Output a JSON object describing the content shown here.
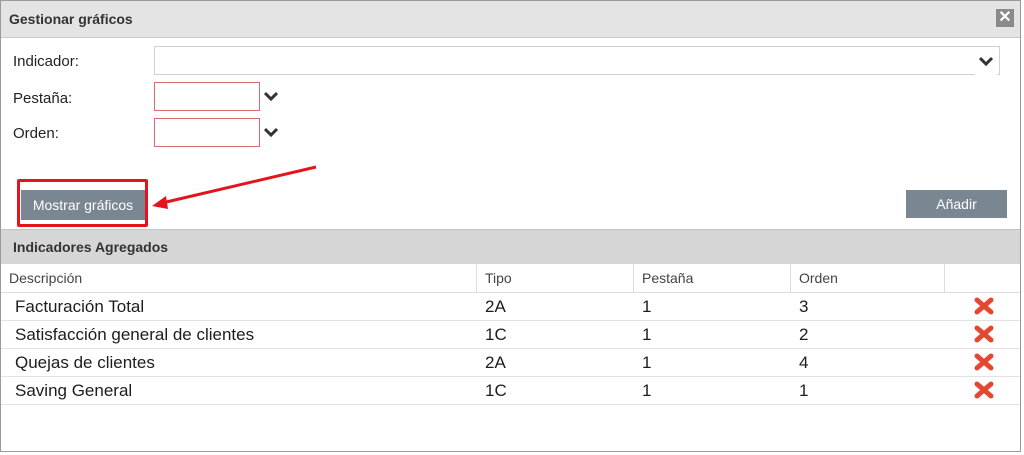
{
  "dialog": {
    "title": "Gestionar gráficos"
  },
  "form": {
    "indicador_label": "Indicador:",
    "pestana_label": "Pestaña:",
    "orden_label": "Orden:",
    "indicador_value": "",
    "pestana_value": "",
    "orden_value": ""
  },
  "buttons": {
    "mostrar": "Mostrar gráficos",
    "anadir": "Añadir"
  },
  "section": {
    "title": "Indicadores Agregados"
  },
  "table": {
    "headers": [
      "Descripción",
      "Tipo",
      "Pestaña",
      "Orden",
      ""
    ],
    "rows": [
      {
        "descripcion": "Facturación Total",
        "tipo": "2A",
        "pestana": "1",
        "orden": "3"
      },
      {
        "descripcion": "Satisfacción general de clientes",
        "tipo": "1C",
        "pestana": "1",
        "orden": "2"
      },
      {
        "descripcion": "Quejas de clientes",
        "tipo": "2A",
        "pestana": "1",
        "orden": "4"
      },
      {
        "descripcion": "Saving General",
        "tipo": "1C",
        "pestana": "1",
        "orden": "1"
      }
    ]
  },
  "icons": {
    "close": "close-icon",
    "chevron": "chevron-down-icon",
    "delete": "delete-x-icon",
    "annotation": "red-arrow"
  },
  "colors": {
    "button": "#7a8793",
    "highlight": "#e3141c",
    "delete": "#e2472f"
  }
}
